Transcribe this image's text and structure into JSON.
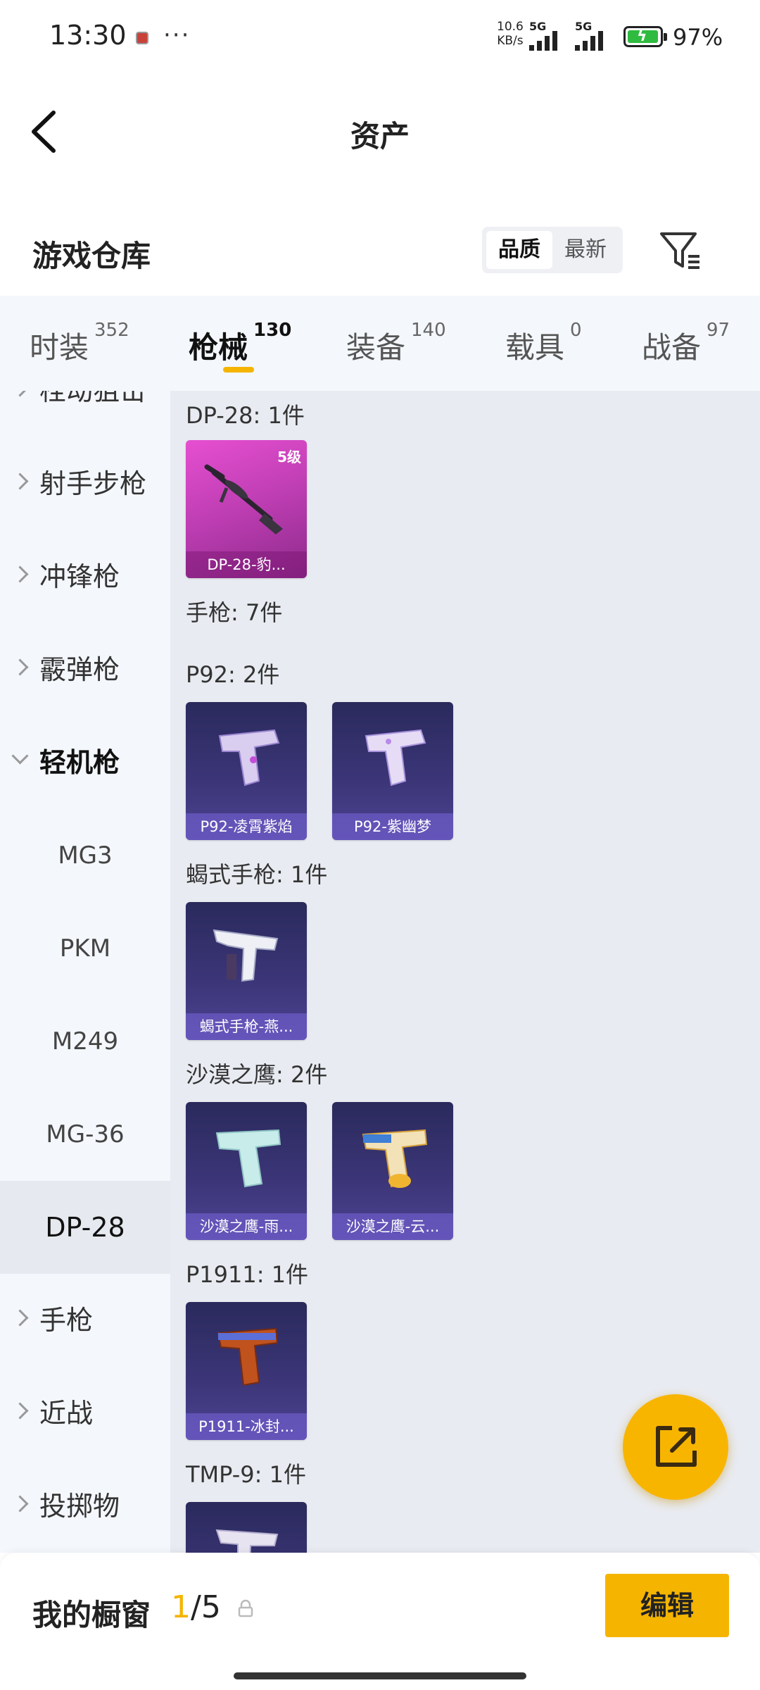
{
  "status_bar": {
    "time": "13:30",
    "dots": "···",
    "speed_value": "10.6",
    "speed_unit": "KB/s",
    "signal1": "5G",
    "signal2": "5G",
    "battery": "97%",
    "battery_fill": 0.97
  },
  "nav": {
    "title": "资产"
  },
  "header": {
    "title": "游戏仓库",
    "sort_options": [
      "品质",
      "最新"
    ],
    "sort_selected": "品质"
  },
  "tabs": [
    {
      "label": "时装",
      "count": "352"
    },
    {
      "label": "枪械",
      "count": "130",
      "active": true
    },
    {
      "label": "装备",
      "count": "140"
    },
    {
      "label": "载具",
      "count": "0"
    },
    {
      "label": "战备",
      "count": "97"
    }
  ],
  "sidebar": {
    "partial": "栓动狙击",
    "items": [
      "射手步枪",
      "冲锋枪",
      "霰弹枪",
      "轻机枪"
    ],
    "sub_items": [
      "MG3",
      "PKM",
      "M249",
      "MG-36",
      "DP-28"
    ],
    "after": [
      "手枪",
      "近战",
      "投掷物"
    ]
  },
  "groups": {
    "dp28": "DP-28: 1件",
    "pistol": "手枪: 7件",
    "p92": "P92: 2件",
    "scorpion": "蝎式手枪: 1件",
    "deagle": "沙漠之鹰: 2件",
    "p1911": "P1911: 1件",
    "tmp9": "TMP-9: 1件"
  },
  "cards": {
    "dp28": {
      "name": "DP-28-豹...",
      "level": "5级"
    },
    "p92_1": {
      "name": "P92-凌霄紫焰"
    },
    "p92_2": {
      "name": "P92-紫幽梦"
    },
    "scorpion": {
      "name": "蝎式手枪-燕..."
    },
    "deagle_1": {
      "name": "沙漠之鹰-雨..."
    },
    "deagle_2": {
      "name": "沙漠之鹰-云..."
    },
    "p1911": {
      "name": "P1911-冰封..."
    }
  },
  "bottom": {
    "title": "我的橱窗",
    "current": "1",
    "total": "/5",
    "edit_label": "编辑"
  },
  "colors": {
    "accent": "#f5b400",
    "card_blue": "#3b3577",
    "card_purple": "#c13fb5"
  }
}
